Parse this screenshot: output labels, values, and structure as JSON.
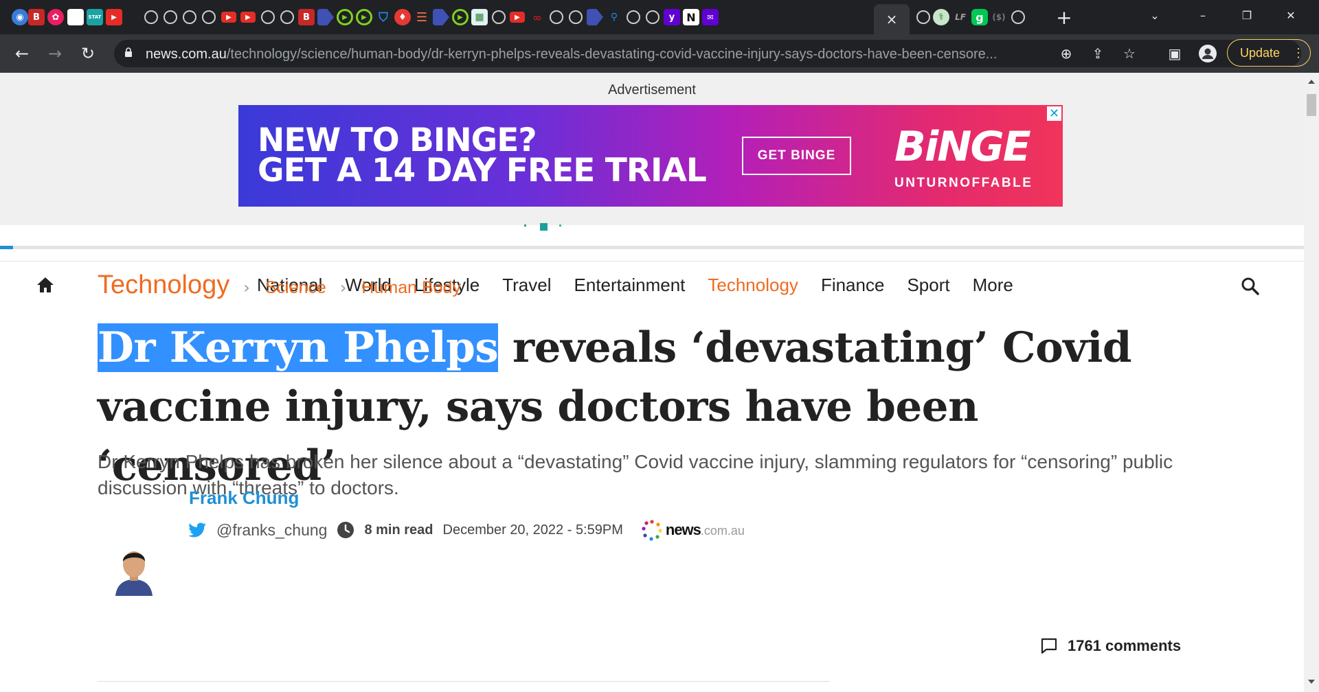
{
  "browser": {
    "active_tab_close": "×",
    "new_tab": "+",
    "window_controls": {
      "dropdown": "⌄",
      "minimize": "–",
      "restore": "❐",
      "close": "✕"
    },
    "url_host": "news.com.au",
    "url_path": "/technology/science/human-body/dr-kerryn-phelps-reveals-devastating-covid-vaccine-injury-says-doctors-have-been-censore...",
    "update_label": "Update"
  },
  "ad": {
    "label": "Advertisement",
    "headline": "NEW TO BINGE?\nGET A 14 DAY FREE TRIAL",
    "cta": "GET BINGE",
    "brand": "BiNGE",
    "tagline": "UNTURNOFFABLE",
    "close": "✕"
  },
  "nav": {
    "links": [
      "National",
      "World",
      "Lifestyle",
      "Travel",
      "Entertainment",
      "Technology",
      "Finance",
      "Sport",
      "More"
    ],
    "active": "Technology"
  },
  "breadcrumb": {
    "section": "Technology",
    "sub1": "Science",
    "sub2": "Human Body"
  },
  "article": {
    "headline_selected": "Dr Kerryn Phelps",
    "headline_rest": " reveals ‘devastating’ Covid vaccine injury, says doctors have been ‘censored’",
    "standfirst": "Dr Kerryn Phelps has broken her silence about a “devastating” Covid vaccine injury, slamming regulators for “censoring” public discussion with “threats” to doctors.",
    "author": "Frank Chung",
    "twitter": "@franks_chung",
    "read_time": "8 min read",
    "date": "December 20, 2022 - 5:59PM",
    "source_name": "news",
    "source_domain": ".com.au",
    "comments": "1761 comments"
  },
  "colors": {
    "accent": "#ef6b1f",
    "link": "#1f8fd6",
    "selection": "#3390ff"
  }
}
